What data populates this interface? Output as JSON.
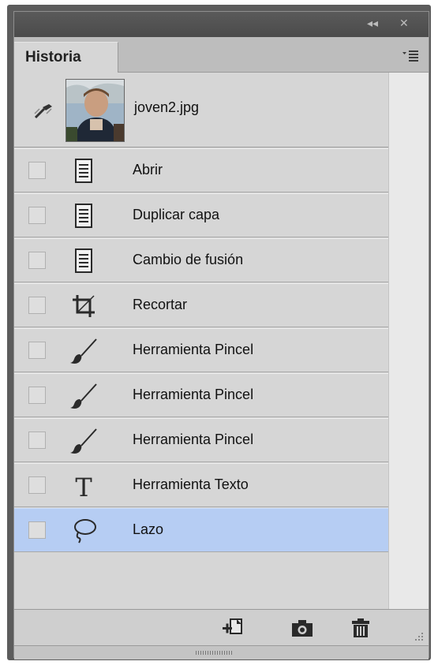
{
  "panel": {
    "tab_label": "Historia",
    "collapse_glyph": "◂◂",
    "close_glyph": "✕"
  },
  "snapshot": {
    "label": "joven2.jpg",
    "source_icon": "history-brush-source-icon"
  },
  "history": [
    {
      "label": "Abrir",
      "icon": "document-icon",
      "selected": false
    },
    {
      "label": "Duplicar capa",
      "icon": "document-icon",
      "selected": false
    },
    {
      "label": "Cambio de fusión",
      "icon": "document-icon",
      "selected": false
    },
    {
      "label": "Recortar",
      "icon": "crop-icon",
      "selected": false
    },
    {
      "label": "Herramienta Pincel",
      "icon": "brush-icon",
      "selected": false
    },
    {
      "label": "Herramienta Pincel",
      "icon": "brush-icon",
      "selected": false
    },
    {
      "label": "Herramienta Pincel",
      "icon": "brush-icon",
      "selected": false
    },
    {
      "label": "Herramienta Texto",
      "icon": "text-tool-icon",
      "selected": false
    },
    {
      "label": "Lazo",
      "icon": "lasso-icon",
      "selected": true
    }
  ],
  "colors": {
    "selected_row": "#b6cdf3",
    "panel_bg": "#d6d6d6",
    "titlebar": "#4b4b4b"
  },
  "footer": {
    "buttons": [
      "new-document-from-state-icon",
      "camera-icon",
      "trash-icon"
    ]
  }
}
